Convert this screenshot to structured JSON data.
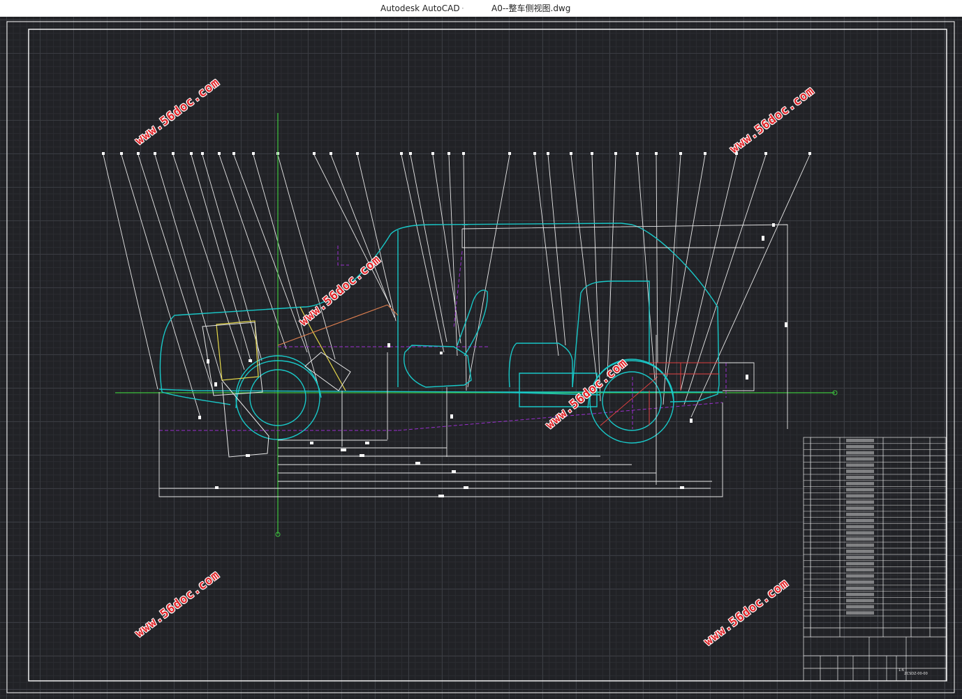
{
  "titlebar": {
    "app_name": "Autodesk AutoCAD",
    "separator": "·",
    "document_name": "A0--整车侧视图.dwg"
  },
  "watermarks": [
    "www.56doc.com",
    "www.56doc.com",
    "www.56doc.com",
    "www.56doc.com",
    "www.56doc.com",
    "www.56doc.com",
    "www.56doc.com"
  ],
  "colors": {
    "background": "#212226",
    "frame": "#ffffff",
    "body_outline": "#19c8c8",
    "axis": "#3ec43e",
    "hidden_line": "#9a2fd0",
    "watermark": "#e0262a",
    "accent_yellow": "#e6d84a",
    "accent_orange": "#e08050"
  },
  "title_block": {
    "drawing_no": "ZCSDZ-00-00",
    "scale": "1:6"
  }
}
